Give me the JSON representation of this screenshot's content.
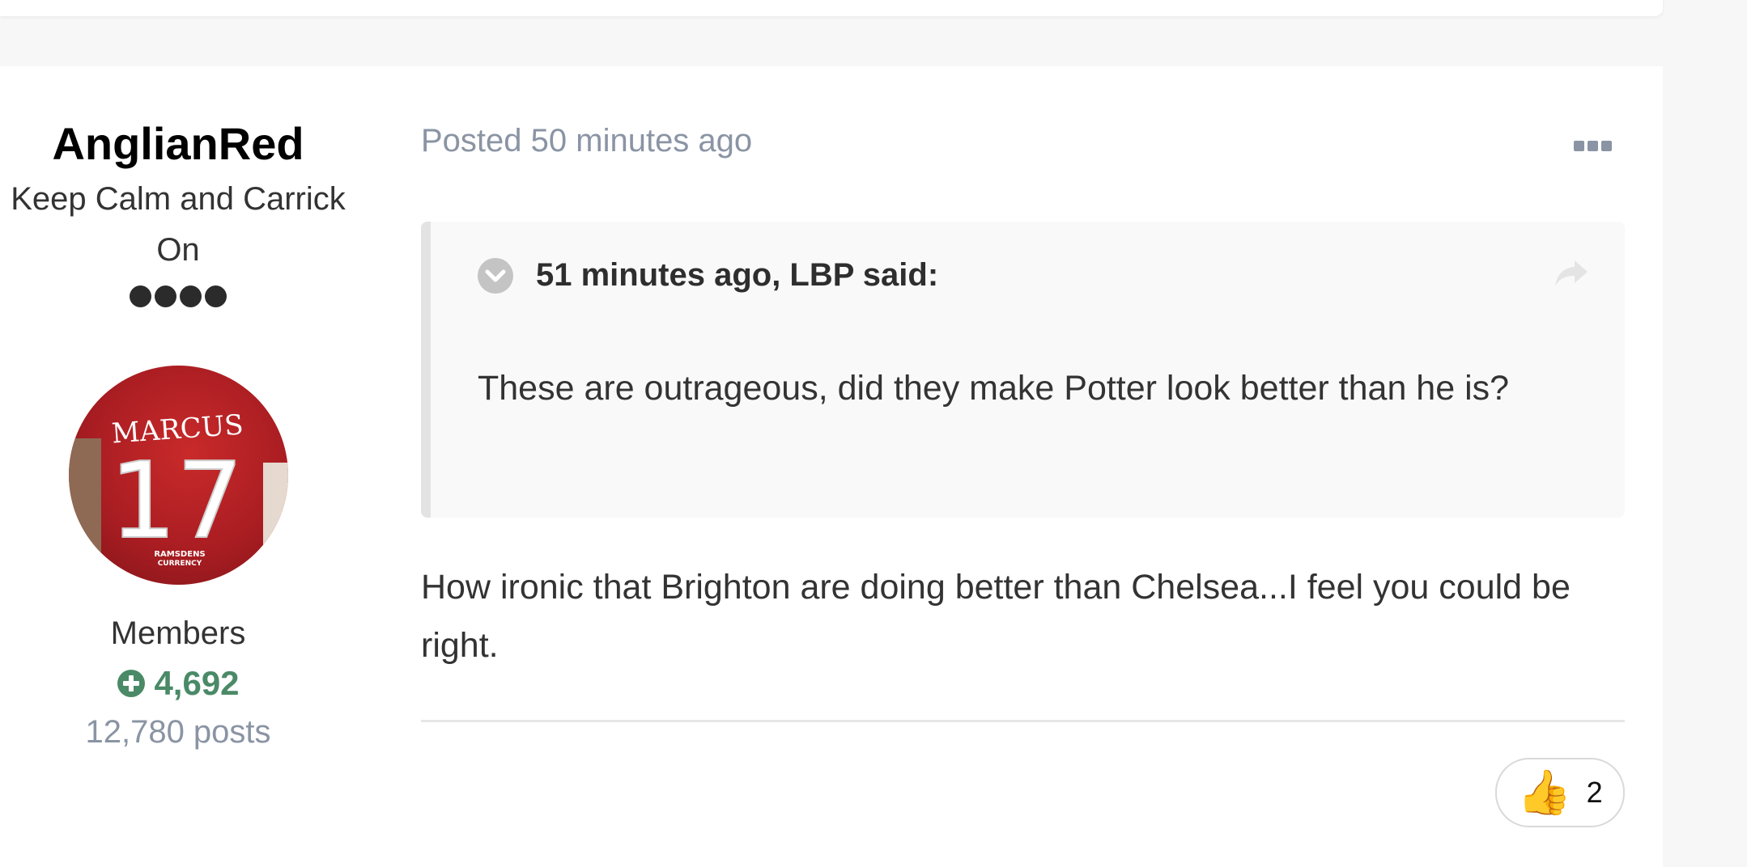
{
  "author": {
    "name": "AnglianRed",
    "title": "Keep Calm and Carrick On",
    "rank_pips": 4,
    "group": "Members",
    "reputation": "4,692",
    "posts": "12,780 posts",
    "avatar": {
      "shirt_name": "MARCUS",
      "shirt_number": "17",
      "sponsor_line1": "RAMSDENS",
      "sponsor_line2": "CURRENCY"
    }
  },
  "post": {
    "meta": "Posted 50 minutes ago",
    "more_icon": "ellipsis-icon",
    "quote": {
      "citation": "51 minutes ago, LBP said:",
      "toggle_icon": "chevron-down-circle-icon",
      "share_icon": "share-arrow-icon",
      "text": "These are outrageous, did they make Potter look better than he is?"
    },
    "body": "How ironic that Brighton are doing better than Chelsea...I feel you could be right.",
    "reaction": {
      "emoji": "👍",
      "icon": "thumbs-up-icon",
      "count": "2"
    }
  },
  "colors": {
    "reputation_green": "#4a8a67",
    "muted_text": "#8a94a4",
    "avatar_red": "#b21f24"
  }
}
